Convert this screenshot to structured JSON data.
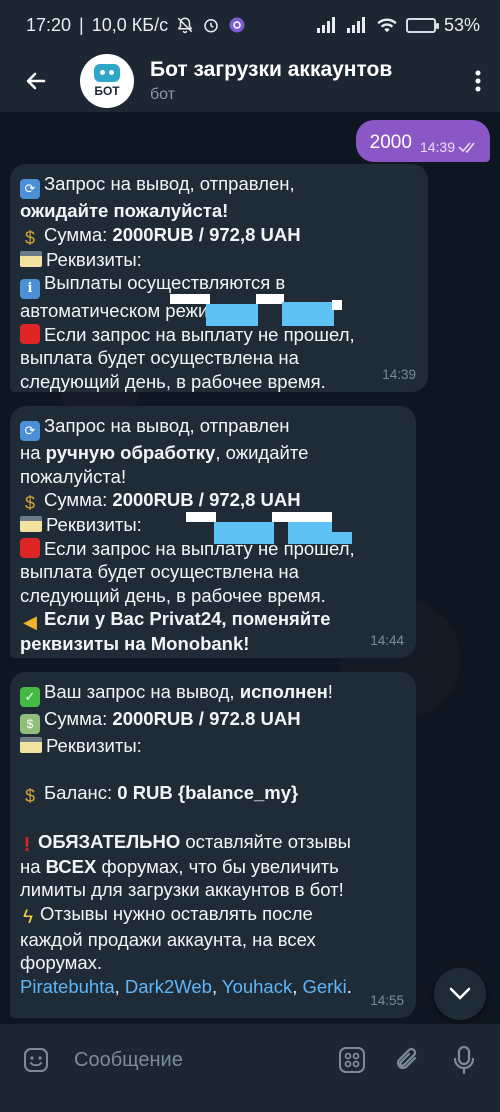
{
  "status": {
    "time": "17:20",
    "speed": "10,0 КБ/с",
    "battery_pct": "53%",
    "battery_level": 0.53
  },
  "header": {
    "avatar_text": "БОТ",
    "title": "Бот загрузки аккаунтов",
    "subtitle": "бот"
  },
  "outgoing": {
    "text": "2000",
    "time": "14:39"
  },
  "messages": [
    {
      "time": "14:39",
      "l1": "Запрос на вывод,  отправлен,",
      "l2_bold": "ожидайте пожалуйста!",
      "l3_pre": "Сумма: ",
      "l3_bold": "2000RUB  / 972,8 UAH",
      "l4": "Реквизиты:",
      "l5": "Выплаты осуществляются в",
      "l6": "автоматическом режиме.",
      "l7": "Если запрос на выплату не прошел,",
      "l8": "выплата будет осуществлена на",
      "l9": "следующий день, в рабочее время."
    },
    {
      "time": "14:44",
      "l1": "Запрос на вывод,  отправлен",
      "l2_pre": "на ",
      "l2_bold": "ручную обработку",
      "l2_post": ", ожидайте",
      "l3": "пожалуйста!",
      "l4_pre": "Сумма: ",
      "l4_bold": "2000RUB  / 972,8 UAH",
      "l5": "Реквизиты:",
      "l6": "Если запрос на выплату не прошел,",
      "l7": "выплата будет осуществлена на",
      "l8": "следующий день, в рабочее время.",
      "l9_bold": "Если у Вас Privat24, поменяйте",
      "l10_bold": "реквизиты на Monobank!"
    },
    {
      "time": "14:55",
      "l1_pre": "Ваш запрос на вывод, ",
      "l1_bold": "исполнен",
      "l1_post": "!",
      "l2_pre": "Сумма: ",
      "l2_bold": "2000RUB  / 972.8 UAH",
      "l3": "Реквизиты:",
      "l4_pre": "Баланс: ",
      "l4_bold": "0 RUB {balance_my}",
      "l5_bold": "ОБЯЗАТЕЛЬНО",
      "l5_post": " оставляйте отзывы",
      "l6_pre": "на ",
      "l6_bold": "ВСЕХ",
      "l6_post": " форумах, что бы увеличить",
      "l7": "лимиты для загрузки аккаунтов в бот!",
      "l8": "Отзывы нужно оставлять после",
      "l9": "каждой продажи аккаунта, на всех",
      "l10": "форумах.",
      "links": [
        "Piratebuhta",
        "Dark2Web",
        "Youhack",
        "Gerki"
      ],
      "sep": ", ",
      "end": "."
    }
  ],
  "input": {
    "placeholder": "Сообщение"
  },
  "colors": {
    "outgoing_bubble": "#8b57c7",
    "incoming_bubble": "#1f2c38",
    "link": "#5eb5f7",
    "header_bg": "#1c2733"
  }
}
